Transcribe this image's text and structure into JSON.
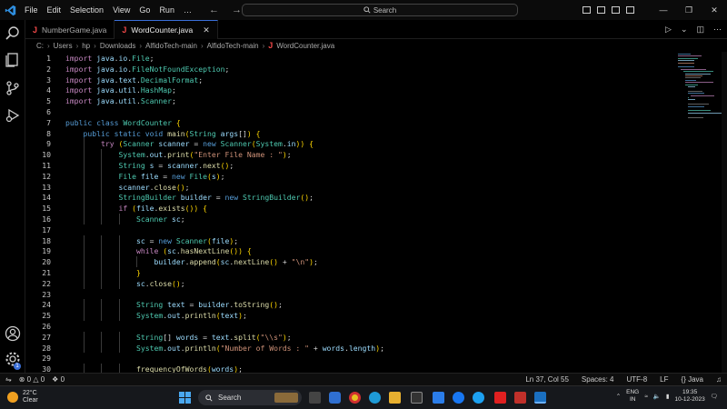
{
  "menu": [
    "File",
    "Edit",
    "Selection",
    "View",
    "Go",
    "Run",
    "…"
  ],
  "search": {
    "label": "Search"
  },
  "tabs": [
    {
      "label": "NumberGame.java",
      "active": false
    },
    {
      "label": "WordCounter.java",
      "active": true
    }
  ],
  "breadcrumb": [
    "C:",
    "Users",
    "hp",
    "Downloads",
    "AlfidoTech-main",
    "AlfidoTech-main",
    "WordCounter.java"
  ],
  "code": {
    "current_line": 37,
    "lines": [
      {
        "n": "1",
        "t": "import java.io.File;"
      },
      {
        "n": "2",
        "t": "import java.io.FileNotFoundException;"
      },
      {
        "n": "3",
        "t": "import java.text.DecimalFormat;"
      },
      {
        "n": "4",
        "t": "import java.util.HashMap;"
      },
      {
        "n": "5",
        "t": "import java.util.Scanner;"
      },
      {
        "n": "6",
        "t": ""
      },
      {
        "n": "7",
        "t": "public class WordCounter {"
      },
      {
        "n": "8",
        "t": "    public static void main(String args[]) {"
      },
      {
        "n": "9",
        "t": "        try (Scanner scanner = new Scanner(System.in)) {"
      },
      {
        "n": "10",
        "t": "            System.out.print(\"Enter File Name : \");"
      },
      {
        "n": "11",
        "t": "            String s = scanner.next();"
      },
      {
        "n": "12",
        "t": "            File file = new File(s);"
      },
      {
        "n": "13",
        "t": "            scanner.close();"
      },
      {
        "n": "14",
        "t": "            StringBuilder builder = new StringBuilder();"
      },
      {
        "n": "15",
        "t": "            if (file.exists()) {"
      },
      {
        "n": "16",
        "t": "                Scanner sc;"
      },
      {
        "n": "17",
        "t": ""
      },
      {
        "n": "18",
        "t": "                sc = new Scanner(file);"
      },
      {
        "n": "19",
        "t": "                while (sc.hasNextLine()) {"
      },
      {
        "n": "20",
        "t": "                    builder.append(sc.nextLine() + \"\\n\");"
      },
      {
        "n": "21",
        "t": "                }"
      },
      {
        "n": "22",
        "t": "                sc.close();"
      },
      {
        "n": "23",
        "t": ""
      },
      {
        "n": "24",
        "t": "                String text = builder.toString();"
      },
      {
        "n": "25",
        "t": "                System.out.println(text);"
      },
      {
        "n": "26",
        "t": ""
      },
      {
        "n": "27",
        "t": "                String[] words = text.split(\"\\\\s\");"
      },
      {
        "n": "28",
        "t": "                System.out.println(\"Number of Words : \" + words.length);"
      },
      {
        "n": "29",
        "t": ""
      },
      {
        "n": "30",
        "t": "                frequencyOfWords(words);"
      }
    ]
  },
  "status": {
    "errors": "0",
    "warnings": "0",
    "ports": "0",
    "position": "Ln 37, Col 55",
    "spaces": "Spaces: 4",
    "encoding": "UTF-8",
    "eol": "LF",
    "language": "Java"
  },
  "taskbar": {
    "weather_temp": "22°C",
    "weather_desc": "Clear",
    "search_label": "Search",
    "lang_line1": "ENG",
    "lang_line2": "IN",
    "time": "19:35",
    "date": "10-12-2023"
  },
  "colors": {
    "keyword": "#569cd6",
    "control": "#c586c0",
    "type": "#4ec9b0",
    "function": "#dcdcaa",
    "string": "#ce9178",
    "variable": "#9cdcfe",
    "accent": "#3a6fd8"
  },
  "icons": [
    "vscode-logo-icon",
    "explorer-icon",
    "search-icon",
    "source-control-icon",
    "run-debug-icon",
    "account-icon",
    "settings-gear-icon"
  ]
}
